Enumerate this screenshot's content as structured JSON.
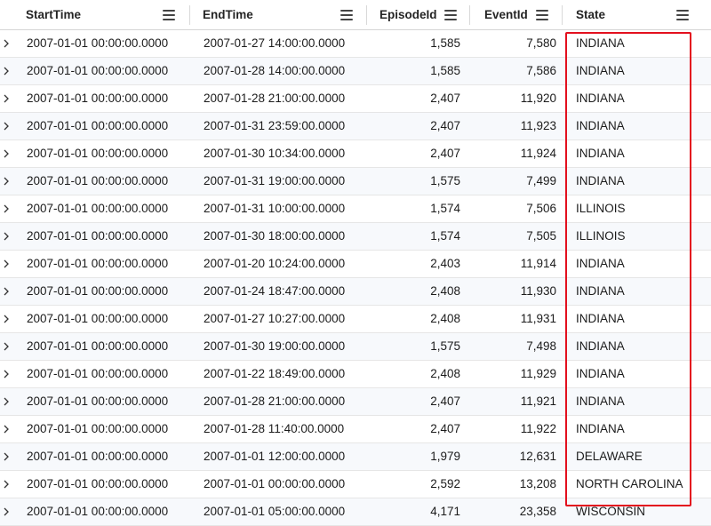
{
  "columns": [
    {
      "key": "start",
      "label": "StartTime"
    },
    {
      "key": "end",
      "label": "EndTime"
    },
    {
      "key": "episode",
      "label": "EpisodeId"
    },
    {
      "key": "event",
      "label": "EventId"
    },
    {
      "key": "state",
      "label": "State"
    }
  ],
  "rows": [
    {
      "start": "2007-01-01 00:00:00.0000",
      "end": "2007-01-27 14:00:00.0000",
      "episode": "1,585",
      "event": "7,580",
      "state": "INDIANA"
    },
    {
      "start": "2007-01-01 00:00:00.0000",
      "end": "2007-01-28 14:00:00.0000",
      "episode": "1,585",
      "event": "7,586",
      "state": "INDIANA"
    },
    {
      "start": "2007-01-01 00:00:00.0000",
      "end": "2007-01-28 21:00:00.0000",
      "episode": "2,407",
      "event": "11,920",
      "state": "INDIANA"
    },
    {
      "start": "2007-01-01 00:00:00.0000",
      "end": "2007-01-31 23:59:00.0000",
      "episode": "2,407",
      "event": "11,923",
      "state": "INDIANA"
    },
    {
      "start": "2007-01-01 00:00:00.0000",
      "end": "2007-01-30 10:34:00.0000",
      "episode": "2,407",
      "event": "11,924",
      "state": "INDIANA"
    },
    {
      "start": "2007-01-01 00:00:00.0000",
      "end": "2007-01-31 19:00:00.0000",
      "episode": "1,575",
      "event": "7,499",
      "state": "INDIANA"
    },
    {
      "start": "2007-01-01 00:00:00.0000",
      "end": "2007-01-31 10:00:00.0000",
      "episode": "1,574",
      "event": "7,506",
      "state": "ILLINOIS"
    },
    {
      "start": "2007-01-01 00:00:00.0000",
      "end": "2007-01-30 18:00:00.0000",
      "episode": "1,574",
      "event": "7,505",
      "state": "ILLINOIS"
    },
    {
      "start": "2007-01-01 00:00:00.0000",
      "end": "2007-01-20 10:24:00.0000",
      "episode": "2,403",
      "event": "11,914",
      "state": "INDIANA"
    },
    {
      "start": "2007-01-01 00:00:00.0000",
      "end": "2007-01-24 18:47:00.0000",
      "episode": "2,408",
      "event": "11,930",
      "state": "INDIANA"
    },
    {
      "start": "2007-01-01 00:00:00.0000",
      "end": "2007-01-27 10:27:00.0000",
      "episode": "2,408",
      "event": "11,931",
      "state": "INDIANA"
    },
    {
      "start": "2007-01-01 00:00:00.0000",
      "end": "2007-01-30 19:00:00.0000",
      "episode": "1,575",
      "event": "7,498",
      "state": "INDIANA"
    },
    {
      "start": "2007-01-01 00:00:00.0000",
      "end": "2007-01-22 18:49:00.0000",
      "episode": "2,408",
      "event": "11,929",
      "state": "INDIANA"
    },
    {
      "start": "2007-01-01 00:00:00.0000",
      "end": "2007-01-28 21:00:00.0000",
      "episode": "2,407",
      "event": "11,921",
      "state": "INDIANA"
    },
    {
      "start": "2007-01-01 00:00:00.0000",
      "end": "2007-01-28 11:40:00.0000",
      "episode": "2,407",
      "event": "11,922",
      "state": "INDIANA"
    },
    {
      "start": "2007-01-01 00:00:00.0000",
      "end": "2007-01-01 12:00:00.0000",
      "episode": "1,979",
      "event": "12,631",
      "state": "DELAWARE"
    },
    {
      "start": "2007-01-01 00:00:00.0000",
      "end": "2007-01-01 00:00:00.0000",
      "episode": "2,592",
      "event": "13,208",
      "state": "NORTH CAROLINA"
    },
    {
      "start": "2007-01-01 00:00:00.0000",
      "end": "2007-01-01 05:00:00.0000",
      "episode": "4,171",
      "event": "23,358",
      "state": "WISCONSIN"
    }
  ],
  "icons": {
    "expand": "chevron-right-icon",
    "column_menu": "menu-icon"
  },
  "highlight_color": "#e3101e"
}
